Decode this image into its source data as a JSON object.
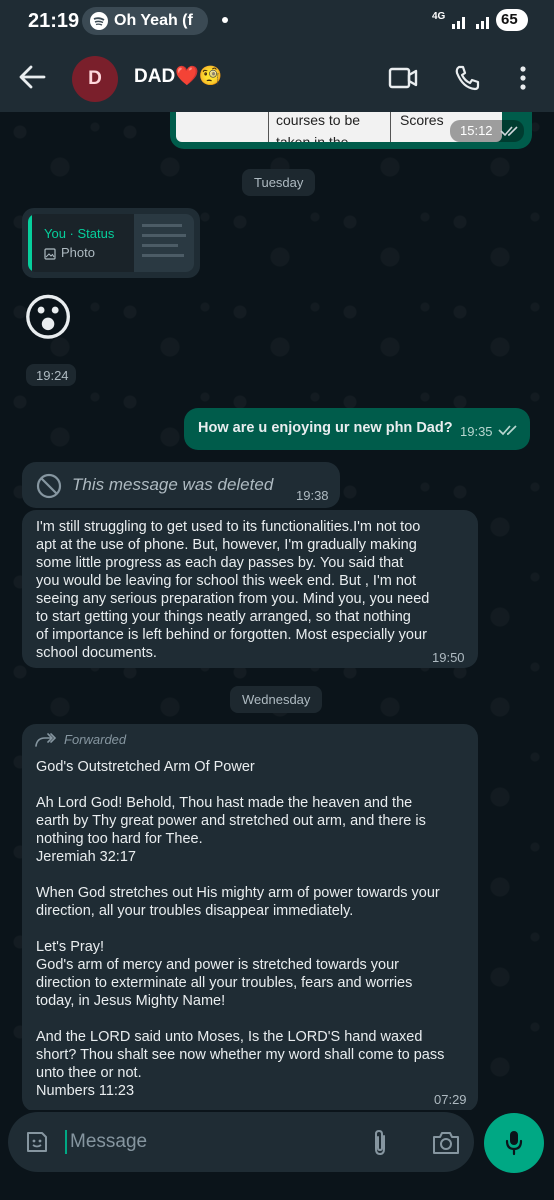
{
  "status_bar": {
    "time": "21:19",
    "media_notification": "Oh Yeah (f",
    "network": "4G",
    "battery": "65"
  },
  "header": {
    "avatar_letter": "D",
    "contact_name": "DAD❤️🧐"
  },
  "chat": {
    "top_partial": {
      "cell_left_line1": "courses to be",
      "cell_left_line2": "taken in the",
      "cell_right": "Scores",
      "time": "15:12"
    },
    "date_tuesday": "Tuesday",
    "status_reply": {
      "author": "You · Status",
      "media_label": "Photo"
    },
    "emoji_message": {
      "emoji": "😮",
      "time": "19:24"
    },
    "outgoing_message": {
      "text": "How are u enjoying ur new phn Dad?",
      "time": "19:35"
    },
    "deleted_message": {
      "text": "This message was deleted",
      "time": "19:38"
    },
    "long_message": {
      "lines": [
        "I'm still struggling to get used to its functionalities.I'm not too",
        "apt at the use of phone. But, however, I'm gradually making",
        "some little progress as each day passes by. You said that",
        "you would be leaving for school this week end. But , I'm not",
        "seeing any serious preparation from you. Mind you, you need",
        "to start getting your things neatly arranged, so that nothing",
        "of importance is left behind or forgotten. Most especially your",
        "school documents."
      ],
      "time": "19:50"
    },
    "date_wednesday": "Wednesday",
    "forwarded_message": {
      "forwarded_label": "Forwarded",
      "lines": [
        "God's Outstretched Arm Of Power",
        "",
        "Ah Lord God! Behold, Thou hast made the heaven and the",
        "earth by Thy great power and stretched out arm, and there is",
        "nothing too hard for Thee.",
        "Jeremiah 32:17",
        "",
        "When God stretches out His mighty arm of power towards your",
        "direction, all your troubles disappear immediately.",
        "",
        "Let's Pray!",
        "God's arm of mercy and power is stretched towards your",
        "direction to exterminate all your troubles, fears and worries",
        "today, in Jesus Mighty Name!",
        "",
        "And the LORD said unto Moses, Is the LORD'S hand waxed",
        "short? Thou shalt see now whether my word shall come to pass",
        "unto thee or not.",
        "Numbers 11:23"
      ],
      "time": "07:29"
    }
  },
  "composer": {
    "placeholder": "Message"
  },
  "colors": {
    "accent_green": "#00a884",
    "outgoing_bubble": "#005c4b",
    "incoming_bubble": "#1f2c34",
    "read_tick": "#53bdeb"
  }
}
